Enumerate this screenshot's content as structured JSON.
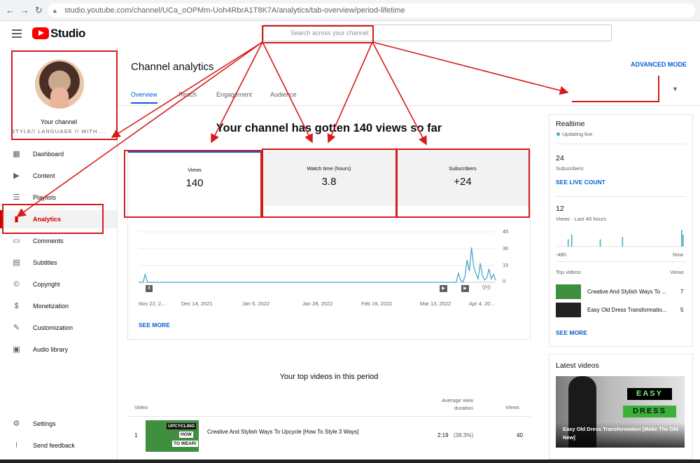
{
  "browser": {
    "back": "←",
    "forward": "→",
    "reload": "↻",
    "url": "studio.youtube.com/channel/UCa_oOPMm-Uoh4RbrA1T8K7A/analytics/tab-overview/period-lifetime"
  },
  "header": {
    "logo_text": "Studio",
    "search_placeholder": "Search across your channel"
  },
  "channel": {
    "title": "Your channel",
    "subtitle": "STYLE// LANGUAGE // WITH ..."
  },
  "sidebar": {
    "items": [
      {
        "label": "Dashboard",
        "icon": "dashboard-icon",
        "glyph": "▦"
      },
      {
        "label": "Content",
        "icon": "content-icon",
        "glyph": "▶"
      },
      {
        "label": "Playlists",
        "icon": "playlists-icon",
        "glyph": "☰"
      },
      {
        "label": "Analytics",
        "icon": "analytics-icon",
        "glyph": "▮",
        "active": true
      },
      {
        "label": "Comments",
        "icon": "comments-icon",
        "glyph": "▭"
      },
      {
        "label": "Subtitles",
        "icon": "subtitles-icon",
        "glyph": "▤"
      },
      {
        "label": "Copyright",
        "icon": "copyright-icon",
        "glyph": "©"
      },
      {
        "label": "Monetization",
        "icon": "monetization-icon",
        "glyph": "$"
      },
      {
        "label": "Customization",
        "icon": "customization-icon",
        "glyph": "✎"
      },
      {
        "label": "Audio library",
        "icon": "audio-library-icon",
        "glyph": "▣"
      }
    ],
    "bottom": [
      {
        "label": "Settings",
        "icon": "settings-icon",
        "glyph": "⚙"
      },
      {
        "label": "Send feedback",
        "icon": "feedback-icon",
        "glyph": "!"
      }
    ]
  },
  "main": {
    "title": "Channel analytics",
    "advanced_mode": "ADVANCED MODE",
    "tabs": [
      "Overview",
      "Reach",
      "Engagement",
      "Audience"
    ],
    "hero": "Your channel has gotten 140 views so far",
    "metrics": [
      {
        "label": "Views",
        "value": "140"
      },
      {
        "label": "Watch time (hours)",
        "value": "3.8"
      },
      {
        "label": "Subscribers",
        "value": "+24"
      }
    ],
    "see_more": "SEE MORE",
    "chart_markers": [
      "4",
      "▶",
      "▶",
      "((•))"
    ],
    "top_videos_title": "Your top videos in this period",
    "table": {
      "col_video": "Video",
      "col_avg": "Average view duration",
      "col_views": "Views",
      "rows": [
        {
          "rank": "1",
          "title": "Creative And Stylish Ways To Upcycle [How To Style 3 Ways]",
          "duration": "2:19",
          "pct": "(38.3%)",
          "views": "40",
          "thumb_top": "UPCYCLING",
          "thumb_mid": "HOW",
          "thumb_bot": "TO WEAR!"
        }
      ]
    }
  },
  "chart_data": {
    "type": "line",
    "x_tick_labels": [
      "Nov 22, 2...",
      "Dec 14, 2021",
      "Jan 5, 2022",
      "Jan 28, 2022",
      "Feb 19, 2022",
      "Mar 13, 2022",
      "Apr 4, 20..."
    ],
    "y_tick_labels": [
      "45",
      "30",
      "15",
      "0"
    ],
    "ylim": [
      0,
      45
    ],
    "series": [
      {
        "values": [
          0,
          0,
          0,
          7,
          0,
          0,
          0,
          0,
          0,
          0,
          0,
          0,
          0,
          0,
          0,
          0,
          0,
          0,
          0,
          0,
          0,
          0,
          0,
          0,
          0,
          0,
          0,
          0,
          0,
          0,
          0,
          0,
          0,
          0,
          0,
          0,
          0,
          0,
          0,
          0,
          0,
          0,
          0,
          0,
          0,
          0,
          0,
          0,
          0,
          0,
          0,
          0,
          0,
          0,
          0,
          0,
          0,
          0,
          0,
          0,
          0,
          0,
          0,
          0,
          0,
          0,
          0,
          0,
          0,
          0,
          0,
          0,
          0,
          0,
          0,
          0,
          0,
          0,
          0,
          0,
          0,
          0,
          0,
          0,
          0,
          0,
          0,
          0,
          0,
          0,
          0,
          0,
          0,
          0,
          0,
          0,
          0,
          0,
          0,
          0,
          0,
          0,
          0,
          0,
          0,
          0,
          0,
          0,
          0,
          0,
          0,
          0,
          0,
          0,
          0,
          0,
          0,
          0,
          0,
          0,
          0,
          0,
          0,
          0,
          0,
          0,
          0,
          0,
          0,
          0,
          0,
          0,
          0,
          0,
          0,
          0,
          0,
          0,
          0,
          0,
          0,
          0,
          0,
          0,
          0,
          0,
          8,
          2,
          0,
          5,
          20,
          10,
          31,
          14,
          8,
          3,
          17,
          6,
          2,
          4,
          12,
          3,
          7,
          2
        ]
      }
    ],
    "color": "#4aa8c9",
    "grid": true
  },
  "realtime": {
    "title": "Realtime",
    "status": "Updating live",
    "subs_value": "24",
    "subs_label": "Subscribers",
    "see_live": "SEE LIVE COUNT",
    "views_value": "12",
    "views_label": "Views · Last 48 hours",
    "bar_left": "-48h",
    "bar_right": "Now",
    "bars": [
      0,
      0,
      0,
      0,
      0,
      0,
      0,
      0,
      0,
      0,
      0,
      0,
      0,
      0,
      0,
      0,
      0,
      3,
      0,
      0,
      0,
      0,
      5,
      0,
      0,
      0,
      0,
      0,
      0,
      0,
      0,
      0,
      0,
      0,
      0,
      0,
      0,
      0,
      0,
      0,
      0,
      0,
      0,
      0,
      0,
      0,
      0,
      0,
      0,
      0,
      0,
      0,
      0,
      0,
      0,
      0,
      0,
      0,
      0,
      0,
      0,
      0,
      0,
      3,
      0,
      0,
      0,
      0,
      0,
      0,
      0,
      0,
      0,
      0,
      0,
      0,
      0,
      0,
      0,
      0,
      0,
      0,
      0,
      0,
      0,
      0,
      0,
      0,
      0,
      0,
      0,
      0,
      0,
      0,
      0,
      4,
      0,
      0,
      0,
      0,
      0,
      0,
      0,
      0,
      0,
      0,
      0,
      0,
      0,
      0,
      0,
      0,
      0,
      0,
      0,
      0,
      0,
      0,
      0,
      0,
      0,
      0,
      0,
      0,
      0,
      0,
      0,
      0,
      0,
      0,
      0,
      0,
      0,
      0,
      0,
      0,
      0,
      0,
      0,
      0,
      0,
      0,
      0,
      0,
      0,
      0,
      0,
      0,
      0,
      0,
      0,
      0,
      0,
      0,
      0,
      0,
      0,
      0,
      0,
      0,
      0,
      0,
      0,
      0,
      0,
      0,
      0,
      0,
      0,
      0,
      0,
      0,
      0,
      0,
      0,
      0,
      0,
      0,
      0,
      0,
      7,
      0,
      5
    ],
    "top_videos_label": "Top videos",
    "top_videos_col": "Views",
    "top_videos": [
      {
        "title": "Creative And Stylish Ways To ...",
        "views": "7"
      },
      {
        "title": "Easy Old Dress Transformatio...",
        "views": "5"
      }
    ],
    "see_more": "SEE MORE"
  },
  "latest": {
    "title": "Latest videos",
    "thumb_line1": "EASY",
    "thumb_line2": "DRESS",
    "caption": "Easy Old Dress Transformation [Make The Old New]"
  },
  "colors": {
    "accent": "#065fd4",
    "brand_red": "#ff0000",
    "annotation_red": "#d51c1c",
    "chart_line": "#4aa8c9"
  }
}
